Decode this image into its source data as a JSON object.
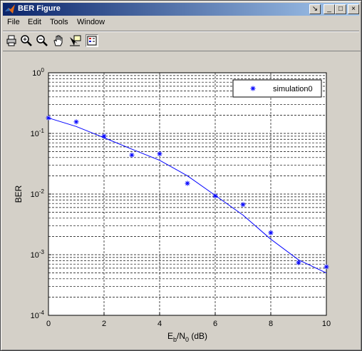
{
  "window": {
    "title": "BER Figure",
    "controls": {
      "minimize": "_",
      "maximize": "□",
      "close": "×",
      "dock": "↘"
    }
  },
  "menu": [
    "File",
    "Edit",
    "Tools",
    "Window"
  ],
  "toolbar": [
    "print-icon",
    "zoom-in-icon",
    "zoom-out-icon",
    "pan-hand-icon",
    "data-cursor-icon",
    "legend-toggle-icon"
  ],
  "colors": {
    "title_start": "#0a246a",
    "title_end": "#a6caf0",
    "series": "#0000ff",
    "face": "#d4d0c8"
  },
  "chart_data": {
    "type": "line",
    "yscale": "log",
    "xlim": [
      0,
      10
    ],
    "ylim": [
      0.0001,
      1
    ],
    "grid": true,
    "legend_position": "top-right",
    "xticks": [
      "0",
      "2",
      "4",
      "6",
      "8",
      "10"
    ],
    "yticks": [
      {
        "base": "10",
        "exp": "0"
      },
      {
        "base": "10",
        "exp": "-1"
      },
      {
        "base": "10",
        "exp": "-2"
      },
      {
        "base": "10",
        "exp": "-3"
      },
      {
        "base": "10",
        "exp": "-4"
      }
    ],
    "xlabel": {
      "a": "E",
      "a_sub": "b",
      "mid": "/N",
      "b_sub": "0",
      "rest": " (dB)"
    },
    "ylabel": "BER",
    "series": [
      {
        "name": "simulation0",
        "marker": "*",
        "x": [
          0,
          1,
          2,
          3,
          4,
          5,
          6,
          7,
          8,
          9,
          10
        ],
        "y": [
          0.18,
          0.155,
          0.09,
          0.044,
          0.046,
          0.015,
          0.0093,
          0.0067,
          0.0023,
          0.00074,
          0.00063
        ]
      },
      {
        "marker": "none",
        "x": [
          0,
          1,
          2,
          3,
          4,
          5,
          6,
          7,
          8,
          9,
          10
        ],
        "y": [
          0.18,
          0.13,
          0.085,
          0.055,
          0.036,
          0.02,
          0.0095,
          0.0045,
          0.0018,
          0.00082,
          0.0005
        ]
      }
    ]
  }
}
